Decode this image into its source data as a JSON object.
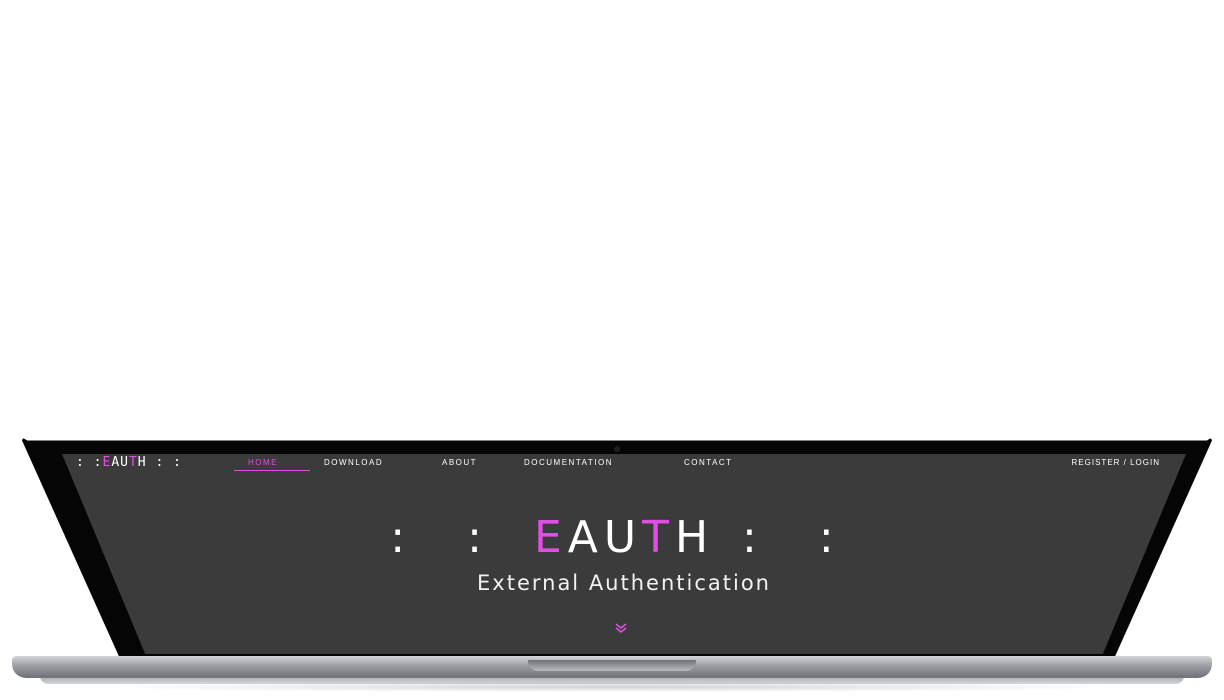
{
  "brand": {
    "prefix": ": :",
    "first": "E",
    "mid": "AU",
    "pink2": "T",
    "last": "H",
    "suffix": ": :"
  },
  "nav": {
    "items": [
      {
        "label": "HOME",
        "active": true
      },
      {
        "label": "DOWNLOAD"
      },
      {
        "label": "ABOUT"
      },
      {
        "label": "DOCUMENTATION"
      },
      {
        "label": "CONTACT"
      }
    ],
    "auth_link": "REGISTER / LOGIN"
  },
  "hero": {
    "prefix": ": :",
    "title_e": "E",
    "title_au": "AU",
    "title_t": "T",
    "title_h": "H",
    "suffix": ": :",
    "subtitle": "External Authentication"
  },
  "colors": {
    "accent": "#e04ee6",
    "screen_bg": "#3b3b3b",
    "text": "#ffffff"
  },
  "icons": {
    "scroll": "chevron-down-icon",
    "camera": "camera-dot"
  }
}
